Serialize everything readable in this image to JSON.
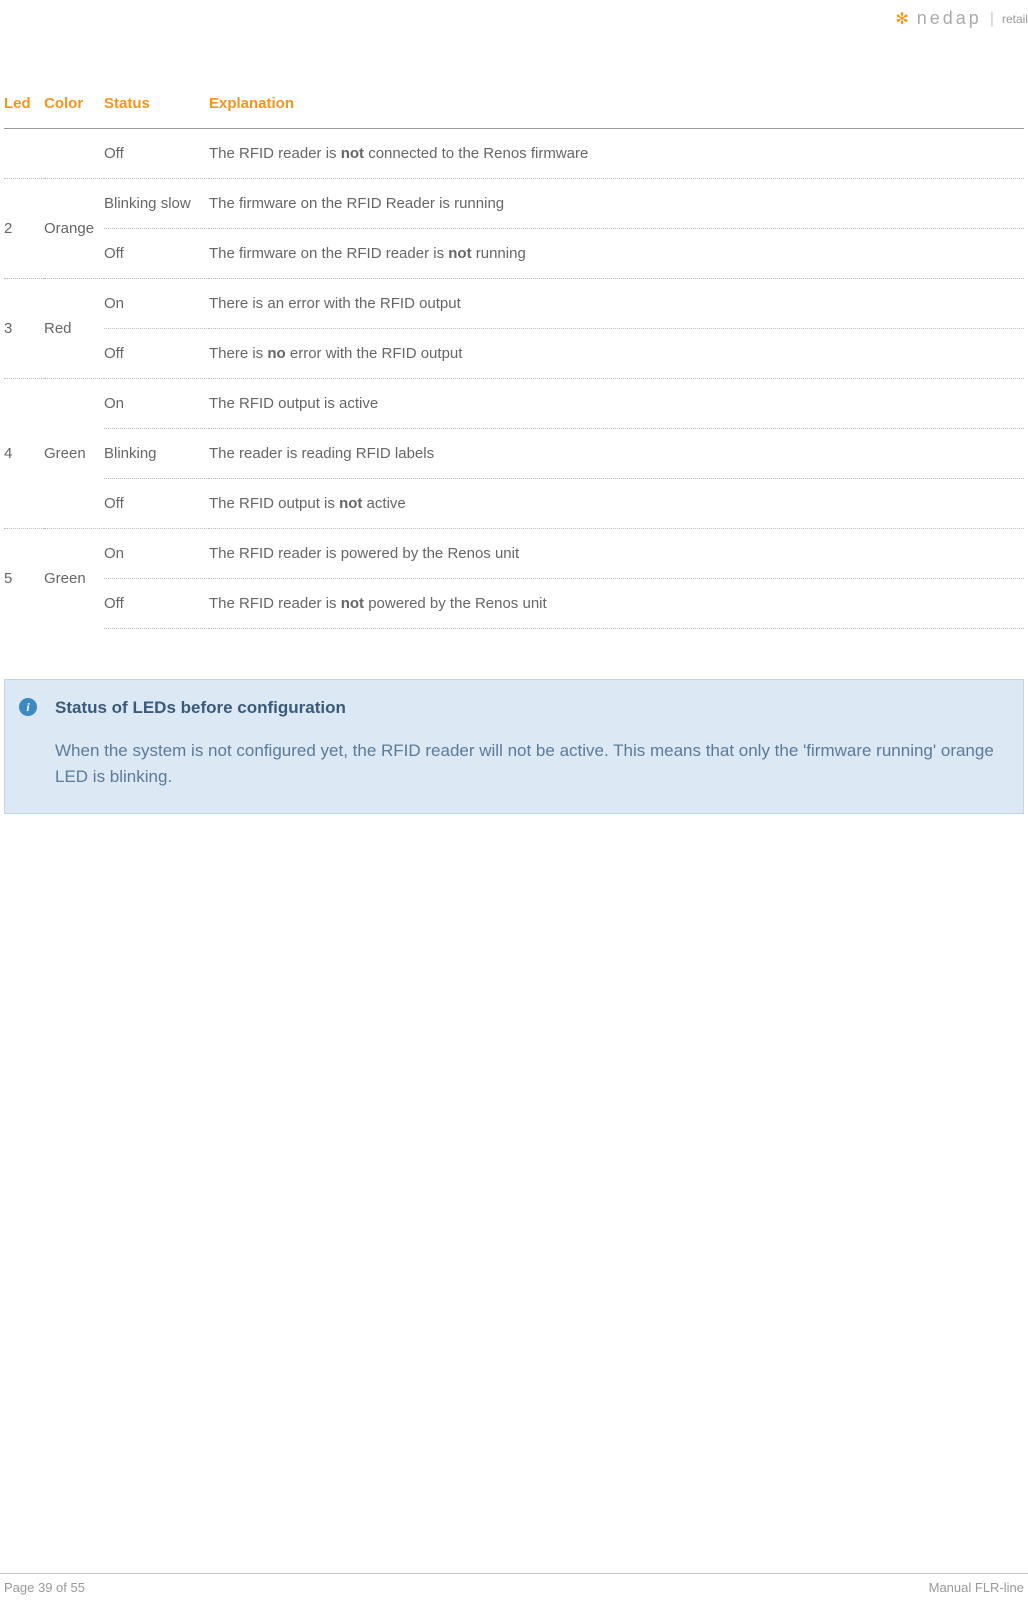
{
  "brand": {
    "name": "nedap",
    "suffix": "retail"
  },
  "table": {
    "headers": {
      "led": "Led",
      "color": "Color",
      "status": "Status",
      "explanation": "Explanation"
    },
    "rows": [
      {
        "led": "",
        "color": "",
        "status": "Off",
        "explanation_pre": "The RFID reader is ",
        "bold": "not",
        "explanation_post": " connected to the Renos firmware",
        "border": "solid",
        "rowspan_start": false
      },
      {
        "led": "2",
        "color": "Orange",
        "status": "Blinking slow",
        "explanation_pre": "The firmware on the RFID Reader is running",
        "bold": "",
        "explanation_post": "",
        "border": "dotted",
        "rowspan_start": true,
        "rowspan": 2
      },
      {
        "led": "",
        "color": "",
        "status": "Off",
        "explanation_pre": "The firmware on the RFID reader is ",
        "bold": "not",
        "explanation_post": " running",
        "border": "inner",
        "rowspan_start": false
      },
      {
        "led": "3",
        "color": "Red",
        "status": "On",
        "explanation_pre": "There is an error with the RFID output",
        "bold": "",
        "explanation_post": "",
        "border": "dotted",
        "rowspan_start": true,
        "rowspan": 2
      },
      {
        "led": "",
        "color": "",
        "status": "Off",
        "explanation_pre": "There is ",
        "bold": "no",
        "explanation_post": " error with the RFID output",
        "border": "inner",
        "rowspan_start": false
      },
      {
        "led": "4",
        "color": "Green",
        "status": "On",
        "explanation_pre": "The RFID output is active",
        "bold": "",
        "explanation_post": "",
        "border": "dotted",
        "rowspan_start": true,
        "rowspan": 3
      },
      {
        "led": "",
        "color": "",
        "status": "Blinking",
        "explanation_pre": "The reader is reading RFID labels",
        "bold": "",
        "explanation_post": "",
        "border": "inner",
        "rowspan_start": false
      },
      {
        "led": "",
        "color": "",
        "status": "Off",
        "explanation_pre": "The RFID output is ",
        "bold": "not",
        "explanation_post": " active",
        "border": "inner",
        "rowspan_start": false
      },
      {
        "led": "5",
        "color": "Green",
        "status": "On",
        "explanation_pre": "The RFID reader is powered by the Renos unit",
        "bold": "",
        "explanation_post": "",
        "border": "dotted",
        "rowspan_start": true,
        "rowspan": 2
      },
      {
        "led": "",
        "color": "",
        "status": "Off",
        "explanation_pre": "The RFID reader is ",
        "bold": "not",
        "explanation_post": " powered by the Renos unit",
        "border": "inner",
        "rowspan_start": false
      }
    ]
  },
  "info": {
    "title": "Status of LEDs before configuration",
    "text": "When the system is not configured yet, the RFID reader will not be active. This means that only the 'firmware running' orange LED is blinking."
  },
  "footer": {
    "page": "Page 39 of 55",
    "manual": "Manual FLR-line"
  }
}
